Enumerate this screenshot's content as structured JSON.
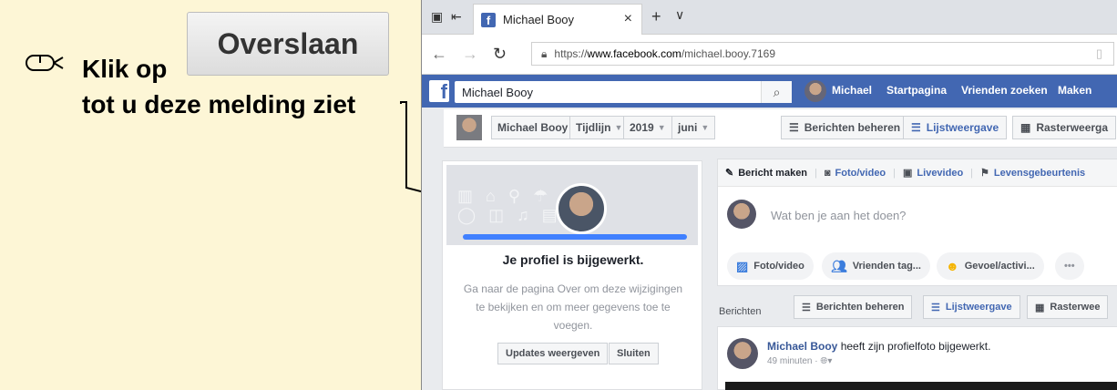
{
  "instruction": {
    "line1": "Klik op",
    "skip_button": "Overslaan",
    "line2": "tot u deze melding ziet"
  },
  "browser": {
    "tab_title": "Michael Booy",
    "tab_close": "×",
    "new_tab": "+",
    "tab_menu": "∨",
    "url_prefix": "https://",
    "url_domain": "www.facebook.com",
    "url_path": "/michael.booy.7169"
  },
  "facebook": {
    "search_value": "Michael Booy",
    "nav_profile": "Michael",
    "nav_home": "Startpagina",
    "nav_friends": "Vrienden zoeken",
    "nav_create": "Maken",
    "brand_color": "#4267b2"
  },
  "timeline": {
    "name": "Michael Booy",
    "tab": "Tijdlijn",
    "year": "2019",
    "month": "juni",
    "manage_posts": "Berichten beheren",
    "list_view": "Lijstweergave",
    "grid_view": "Rasterweerga"
  },
  "profile_card": {
    "title": "Je profiel is bijgewerkt.",
    "description": "Ga naar de pagina Over om deze wijzigingen te bekijken en om meer gegevens toe te voegen.",
    "updates_button": "Updates weergeven",
    "close_button": "Sluiten",
    "progress": 1.0
  },
  "composer": {
    "tab_post": "Bericht maken",
    "tab_photo": "Foto/video",
    "tab_live": "Livevideo",
    "tab_life": "Levensgebeurtenis",
    "placeholder": "Wat ben je aan het doen?",
    "chip_photo": "Foto/video",
    "chip_tag": "Vrienden tag...",
    "chip_feeling": "Gevoel/activi...",
    "chip_more": "•••"
  },
  "posts_bar": {
    "label": "Berichten",
    "manage": "Berichten beheren",
    "list": "Lijstweergave",
    "grid": "Rasterwee"
  },
  "post": {
    "author": "Michael Booy",
    "action": " heeft zijn profielfoto bijgewerkt.",
    "time": "49 minuten · "
  }
}
